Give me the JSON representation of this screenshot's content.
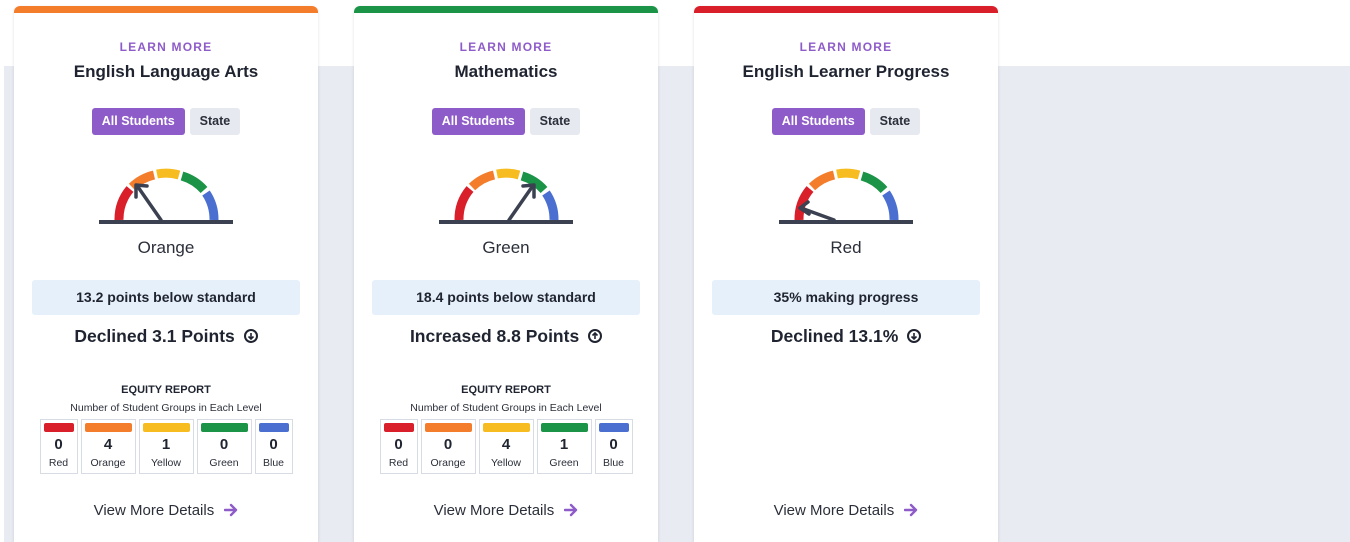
{
  "colors": {
    "red": "#d81f2a",
    "orange": "#f47d2c",
    "yellow": "#f7bc1f",
    "green": "#1c9447",
    "blue": "#4a6fd1",
    "accent": "#8e5cc9",
    "status_box": "#e5f0fb"
  },
  "cards": [
    {
      "learn_more": "LEARN MORE",
      "title": "English Language Arts",
      "tabs": [
        {
          "label": "All Students",
          "active": true
        },
        {
          "label": "State",
          "active": false
        }
      ],
      "level": "Orange",
      "status": "13.2 points below standard",
      "change": "Declined 3.1 Points",
      "change_direction": "down",
      "equity": {
        "title": "EQUITY REPORT",
        "subtitle": "Number of Student Groups in Each Level",
        "levels": [
          {
            "count": "0",
            "label": "Red"
          },
          {
            "count": "4",
            "label": "Orange"
          },
          {
            "count": "1",
            "label": "Yellow"
          },
          {
            "count": "0",
            "label": "Green"
          },
          {
            "count": "0",
            "label": "Blue"
          }
        ]
      },
      "details": "View More Details",
      "top_color": "orange",
      "needle_icon": "gauge-needle-icon"
    },
    {
      "learn_more": "LEARN MORE",
      "title": "Mathematics",
      "tabs": [
        {
          "label": "All Students",
          "active": true
        },
        {
          "label": "State",
          "active": false
        }
      ],
      "level": "Green",
      "status": "18.4 points below standard",
      "change": "Increased 8.8 Points",
      "change_direction": "up",
      "equity": {
        "title": "EQUITY REPORT",
        "subtitle": "Number of Student Groups in Each Level",
        "levels": [
          {
            "count": "0",
            "label": "Red"
          },
          {
            "count": "0",
            "label": "Orange"
          },
          {
            "count": "4",
            "label": "Yellow"
          },
          {
            "count": "1",
            "label": "Green"
          },
          {
            "count": "0",
            "label": "Blue"
          }
        ]
      },
      "details": "View More Details",
      "top_color": "green",
      "needle_icon": "gauge-needle-icon"
    },
    {
      "learn_more": "LEARN MORE",
      "title": "English Learner Progress",
      "tabs": [
        {
          "label": "All Students",
          "active": true
        },
        {
          "label": "State",
          "active": false
        }
      ],
      "level": "Red",
      "status": "35% making progress",
      "change": "Declined 13.1%",
      "change_direction": "down",
      "details": "View More Details",
      "top_color": "red",
      "needle_icon": "gauge-needle-icon"
    }
  ]
}
